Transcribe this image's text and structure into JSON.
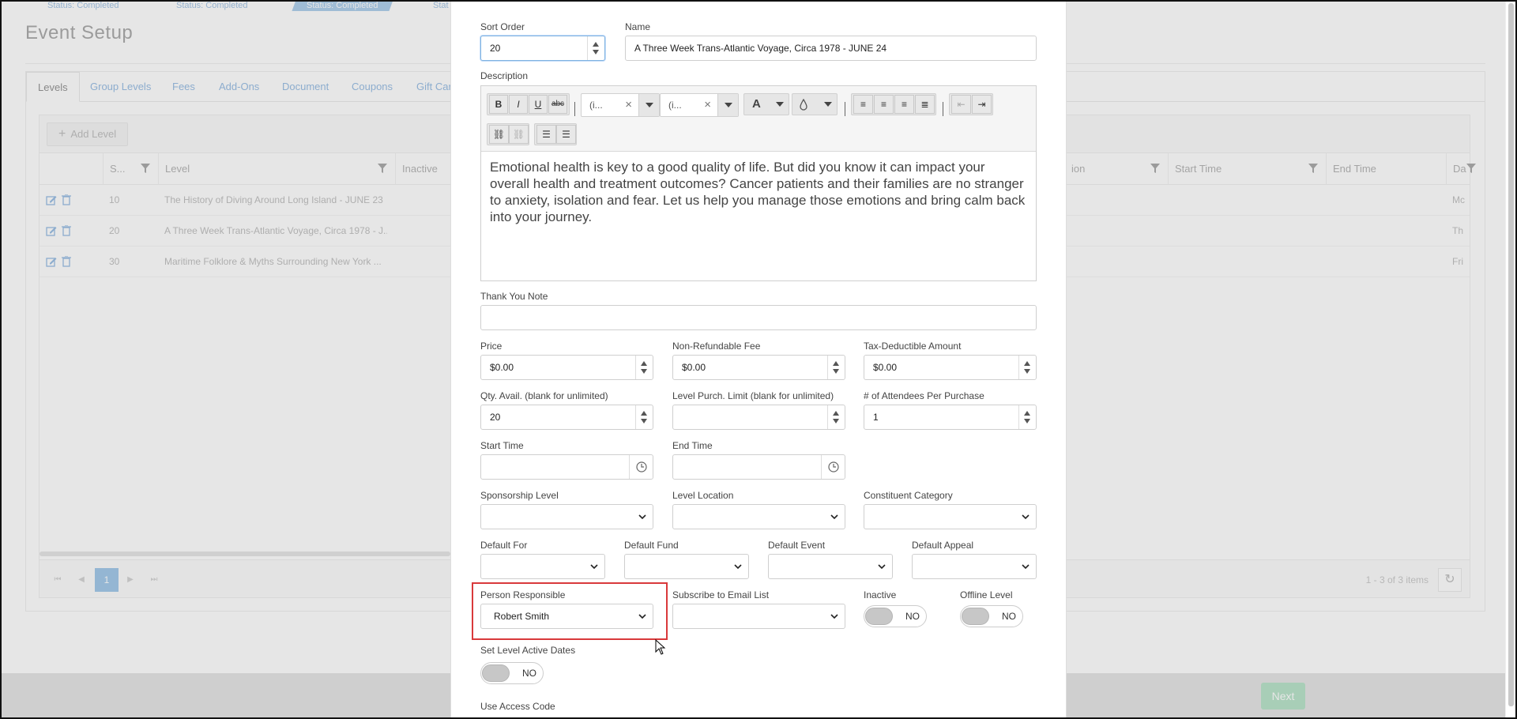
{
  "background": {
    "steps": [
      "Status: Completed",
      "Status: Completed",
      "Status: Completed",
      "Stat"
    ],
    "page_title": "Event Setup",
    "tabs": [
      "Levels",
      "Group Levels",
      "Fees",
      "Add-Ons",
      "Document",
      "Coupons",
      "Gift Card"
    ],
    "add_level": "Add Level",
    "columns": {
      "sort": "S...",
      "level": "Level",
      "inactive": "Inactive",
      "location": "ion",
      "start_time": "Start Time",
      "end_time": "End Time",
      "day": "Da"
    },
    "rows": [
      {
        "sort": "10",
        "level": "The History of Diving Around Long Island - JUNE 23",
        "day": "Mc"
      },
      {
        "sort": "20",
        "level": "A Three Week Trans-Atlantic Voyage, Circa 1978 - J...",
        "day": "Th"
      },
      {
        "sort": "30",
        "level": "Maritime Folklore & Myths Surrounding New York ...",
        "day": "Fri"
      }
    ],
    "pager": {
      "current": "1",
      "info": "1 - 3 of 3 items"
    },
    "next_button": "Next"
  },
  "modal": {
    "sort_order": {
      "label": "Sort Order",
      "value": "20"
    },
    "name": {
      "label": "Name",
      "value": "A Three Week Trans-Atlantic Voyage, Circa 1978 - JUNE 24"
    },
    "description": {
      "label": "Description",
      "font_name": "(i...",
      "font_size": "(i...",
      "text": "Emotional health is key to a good quality of life. But did you know it can impact your overall health and treatment outcomes? Cancer patients and their families are no stranger to anxiety, isolation and fear. Let us help you manage those emotions and bring calm back into your journey."
    },
    "thank_you_note": {
      "label": "Thank You Note",
      "value": ""
    },
    "price": {
      "label": "Price",
      "value": "$0.00"
    },
    "non_refundable_fee": {
      "label": "Non-Refundable Fee",
      "value": "$0.00"
    },
    "tax_deductible": {
      "label": "Tax-Deductible Amount",
      "value": "$0.00"
    },
    "qty_avail": {
      "label": "Qty. Avail. (blank for unlimited)",
      "value": "20"
    },
    "purch_limit": {
      "label": "Level Purch. Limit (blank for unlimited)",
      "value": ""
    },
    "attendees": {
      "label": "# of Attendees Per Purchase",
      "value": "1"
    },
    "start_time": {
      "label": "Start Time",
      "value": ""
    },
    "end_time": {
      "label": "End Time",
      "value": ""
    },
    "sponsorship_level": {
      "label": "Sponsorship Level",
      "value": ""
    },
    "level_location": {
      "label": "Level Location",
      "value": ""
    },
    "constituent_category": {
      "label": "Constituent Category",
      "value": ""
    },
    "default_for": {
      "label": "Default For",
      "value": ""
    },
    "default_fund": {
      "label": "Default Fund",
      "value": ""
    },
    "default_event": {
      "label": "Default Event",
      "value": ""
    },
    "default_appeal": {
      "label": "Default Appeal",
      "value": ""
    },
    "person_responsible": {
      "label": "Person Responsible",
      "value": "Robert Smith"
    },
    "subscribe_email": {
      "label": "Subscribe to Email List",
      "value": ""
    },
    "inactive": {
      "label": "Inactive",
      "value": "NO"
    },
    "offline_level": {
      "label": "Offline Level",
      "value": "NO"
    },
    "active_dates": {
      "label": "Set Level Active Dates",
      "value": "NO"
    },
    "access_code": {
      "label": "Use Access Code"
    }
  },
  "colors": {
    "accent": "#5b96d3",
    "highlight": "#d9393b",
    "next": "#8fd4a9"
  }
}
